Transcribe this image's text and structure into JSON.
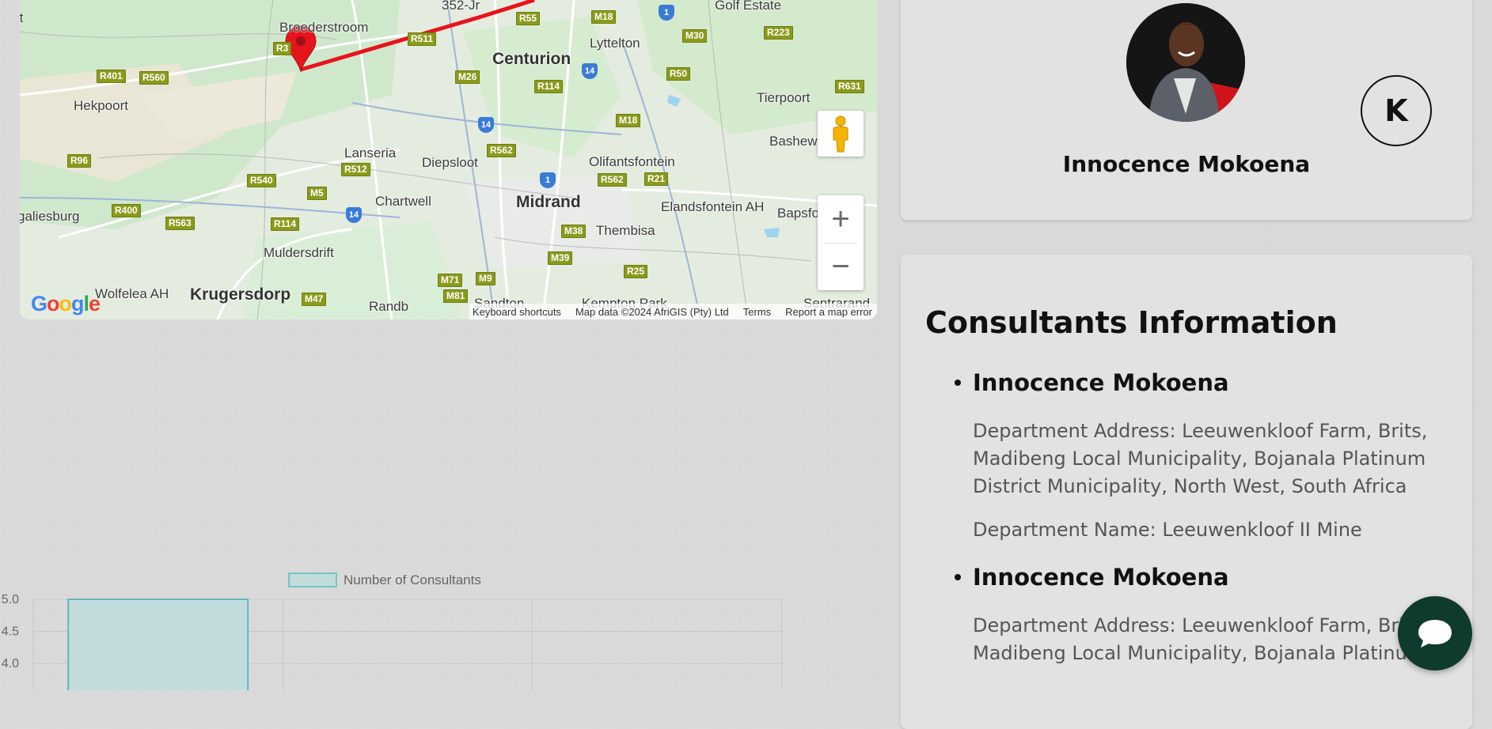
{
  "map": {
    "places": [
      {
        "text": "Golf Estate",
        "big": false
      },
      {
        "text": "Broederstroom",
        "big": false
      },
      {
        "text": "352-Jr",
        "big": false
      },
      {
        "text": "Lyttelton",
        "big": false
      },
      {
        "text": "Centurion",
        "big": true
      },
      {
        "text": "Hekpoort",
        "big": false
      },
      {
        "text": "Tierpoort",
        "big": false
      },
      {
        "text": "Bashew",
        "big": false
      },
      {
        "text": "Lanseria",
        "big": false
      },
      {
        "text": "Diepsloot",
        "big": false
      },
      {
        "text": "Olifantsfontein",
        "big": false
      },
      {
        "text": "Chartwell",
        "big": false
      },
      {
        "text": "Midrand",
        "big": true
      },
      {
        "text": "Elandsfontein AH",
        "big": false
      },
      {
        "text": "Bapsfo",
        "big": false
      },
      {
        "text": "galiesburg",
        "big": false
      },
      {
        "text": "Thembisa",
        "big": false
      },
      {
        "text": "Muldersdrift",
        "big": false
      },
      {
        "text": "Wolfelea AH",
        "big": false
      },
      {
        "text": "Krugersdorp",
        "big": true
      },
      {
        "text": "Randb",
        "big": false
      },
      {
        "text": "Kempton Park",
        "big": false
      },
      {
        "text": "Sentrarand",
        "big": false
      },
      {
        "text": "rt",
        "big": false
      },
      {
        "text": "Sandton",
        "big": false
      }
    ],
    "routes": [
      "R55",
      "M18",
      "R511",
      "M30",
      "R223",
      "R401",
      "R560",
      "M26",
      "R114",
      "R50",
      "R631",
      "M18",
      "R96",
      "R562",
      "R540",
      "R512",
      "M5",
      "R562",
      "R21",
      "R400",
      "R563",
      "R114",
      "M38",
      "M39",
      "M71",
      "M9",
      "R25",
      "M47",
      "M81",
      "R3",
      "R512"
    ],
    "national_routes": [
      "1",
      "14",
      "14",
      "1",
      "14"
    ],
    "keyboard_shortcuts": "Keyboard shortcuts",
    "map_data": "Map data ©2024 AfriGIS (Pty) Ltd",
    "terms": "Terms",
    "report": "Report a map error",
    "google_logo": "Google",
    "zoom_in": "+",
    "zoom_out": "−",
    "route_color": "#e8141c"
  },
  "profile": {
    "name": "Innocence Mokoena",
    "initial": "K"
  },
  "consultants": {
    "title": "Consultants Information",
    "items": [
      {
        "name": "Innocence Mokoena",
        "address": "Department Address: Leeuwenkloof Farm, Brits, Madibeng Local Municipality, Bojanala Platinum District Municipality, North West, South Africa",
        "department": "Department Name: Leeuwenkloof II Mine"
      },
      {
        "name": "Innocence Mokoena",
        "address": "Department Address: Leeuwenkloof Farm, Brits, Madibeng Local Municipality, Bojanala Platinum",
        "department": ""
      }
    ]
  },
  "chart_data": {
    "type": "bar",
    "categories": [
      "",
      "",
      ""
    ],
    "series": [
      {
        "name": "Number of Consultants",
        "values": [
          5,
          null,
          null
        ]
      }
    ],
    "yticks": [
      "5.0",
      "4.5",
      "4.0"
    ],
    "ylim_visible": [
      3.9,
      5.0
    ],
    "grid": true,
    "legend": "top",
    "bar_fill": "#c2dcdc",
    "bar_stroke": "#5fb8c0"
  }
}
